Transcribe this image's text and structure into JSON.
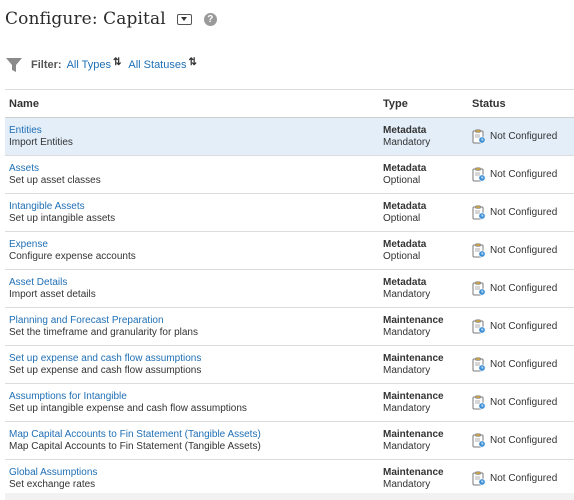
{
  "header": {
    "title": "Configure: Capital",
    "help_symbol": "?"
  },
  "filter": {
    "label": "Filter:",
    "types": "All Types",
    "statuses": "All Statuses",
    "swap_symbol": "⇅"
  },
  "table": {
    "columns": {
      "name": "Name",
      "type": "Type",
      "status": "Status"
    },
    "rows": [
      {
        "name": "Entities",
        "description": "Import Entities",
        "type": "Metadata",
        "requirement": "Mandatory",
        "status": "Not Configured"
      },
      {
        "name": "Assets",
        "description": "Set up asset classes",
        "type": "Metadata",
        "requirement": "Optional",
        "status": "Not Configured"
      },
      {
        "name": "Intangible Assets",
        "description": "Set up intangible assets",
        "type": "Metadata",
        "requirement": "Optional",
        "status": "Not Configured"
      },
      {
        "name": "Expense",
        "description": "Configure expense accounts",
        "type": "Metadata",
        "requirement": "Optional",
        "status": "Not Configured"
      },
      {
        "name": "Asset Details",
        "description": "Import asset details",
        "type": "Metadata",
        "requirement": "Mandatory",
        "status": "Not Configured"
      },
      {
        "name": "Planning and Forecast Preparation",
        "description": "Set the timeframe and granularity for plans",
        "type": "Maintenance",
        "requirement": "Mandatory",
        "status": "Not Configured"
      },
      {
        "name": "Set up expense and cash flow assumptions",
        "description": "Set up expense and cash flow assumptions",
        "type": "Maintenance",
        "requirement": "Mandatory",
        "status": "Not Configured"
      },
      {
        "name": "Assumptions for Intangible",
        "description": "Set up intangible expense and cash flow assumptions",
        "type": "Maintenance",
        "requirement": "Mandatory",
        "status": "Not Configured"
      },
      {
        "name": "Map Capital Accounts to Fin Statement (Tangible Assets)",
        "description": "Map Capital Accounts to Fin Statement (Tangible Assets)",
        "type": "Maintenance",
        "requirement": "Mandatory",
        "status": "Not Configured"
      },
      {
        "name": "Global Assumptions",
        "description": "Set exchange rates",
        "type": "Maintenance",
        "requirement": "Mandatory",
        "status": "Not Configured"
      }
    ]
  },
  "colors": {
    "link": "#1f6fb5",
    "selected_row": "#e3eef9",
    "text": "#333333"
  }
}
